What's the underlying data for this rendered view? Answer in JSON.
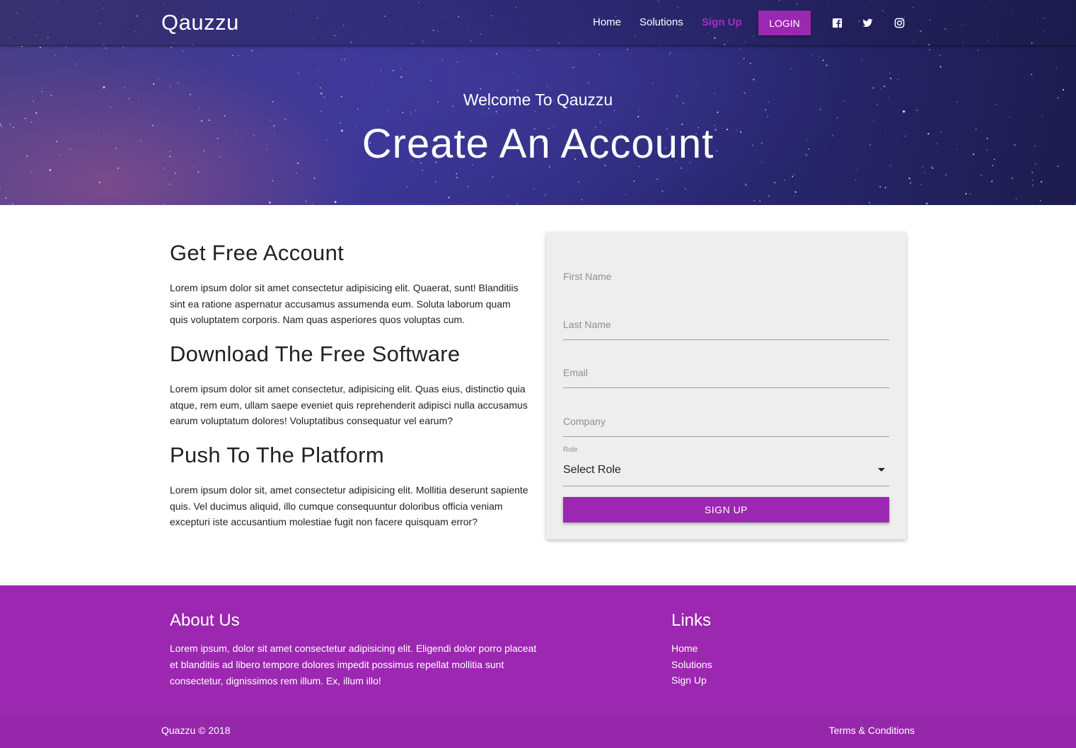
{
  "colors": {
    "accent": "#9c27b0",
    "active_nav": "#a22fc0",
    "form_background": "#eeeeee",
    "footer_background": "#9c27b0"
  },
  "navbar": {
    "brand": "Qauzzu",
    "links": [
      "Home",
      "Solutions",
      "Sign Up"
    ],
    "active_link": "Sign Up",
    "login_label": "LOGIN",
    "social_icons": [
      "facebook-icon",
      "twitter-icon",
      "instagram-icon"
    ]
  },
  "hero": {
    "subtitle": "Welcome To Qauzzu",
    "title": "Create An Account"
  },
  "info": {
    "sections": [
      {
        "heading": "Get Free Account",
        "body": "Lorem ipsum dolor sit amet consectetur adipisicing elit. Quaerat, sunt! Blanditiis sint ea ratione aspernatur accusamus assumenda eum. Soluta laborum quam quis voluptatem corporis. Nam quas asperiores quos voluptas cum."
      },
      {
        "heading": "Download The Free Software",
        "body": "Lorem ipsum dolor sit amet consectetur, adipisicing elit. Quas eius, distinctio quia atque, rem eum, ullam saepe eveniet quis reprehenderit adipisci nulla accusamus earum voluptatum dolores! Voluptatibus consequatur vel earum?"
      },
      {
        "heading": "Push To The Platform",
        "body": "Lorem ipsum dolor sit, amet consectetur adipisicing elit. Mollitia deserunt sapiente quis. Vel ducimus aliquid, illo cumque consequuntur doloribus officia veniam excepturi iste accusantium molestiae fugit non facere quisquam error?"
      }
    ]
  },
  "form": {
    "fields": [
      {
        "placeholder": "First Name",
        "value": ""
      },
      {
        "placeholder": "Last Name",
        "value": ""
      },
      {
        "placeholder": "Email",
        "value": ""
      },
      {
        "placeholder": "Company",
        "value": ""
      }
    ],
    "role_label": "Role",
    "role_selected": "Select Role",
    "submit_label": "SIGN UP"
  },
  "footer": {
    "about_heading": "About Us",
    "about_text": "Lorem ipsum, dolor sit amet consectetur adipisicing elit. Eligendi dolor porro placeat et blanditiis ad libero tempore dolores impedit possimus repellat mollitia sunt consectetur, dignissimos rem illum. Ex, illum illo!",
    "links_heading": "Links",
    "links": [
      "Home",
      "Solutions",
      "Sign Up"
    ],
    "copyright": "Quazzu © 2018",
    "terms": "Terms & Conditions"
  }
}
